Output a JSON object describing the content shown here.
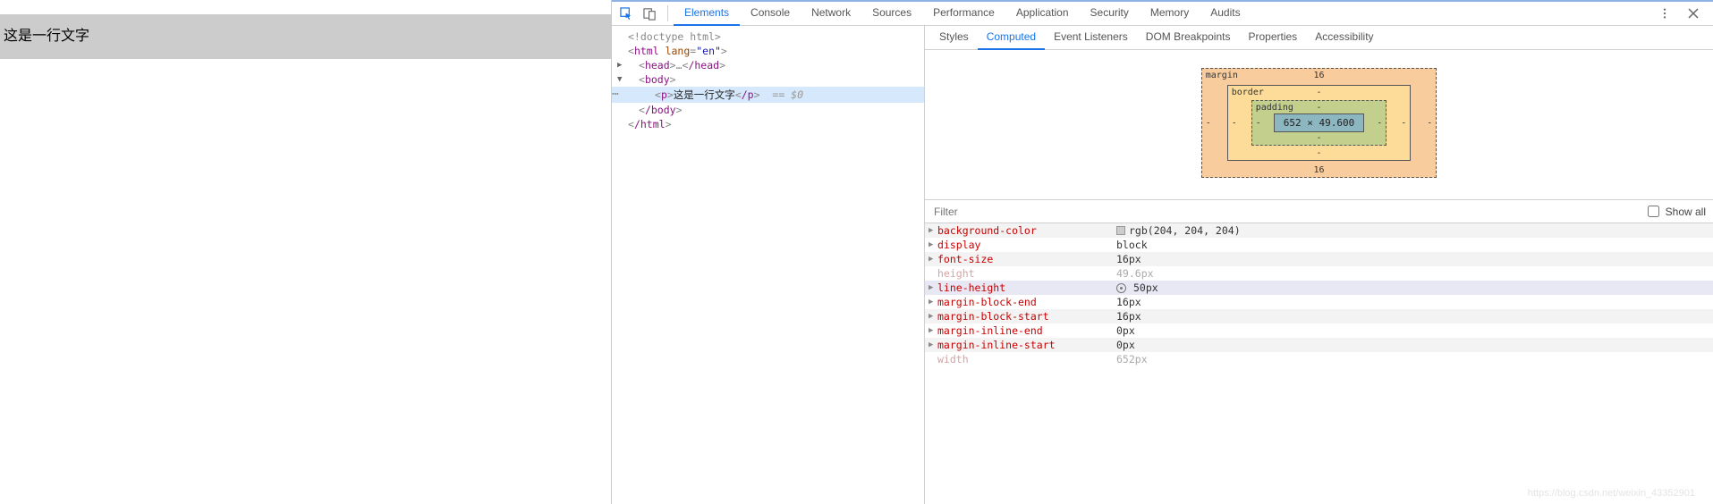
{
  "page": {
    "paragraph_text": "这是一行文字"
  },
  "devtools": {
    "main_tabs": [
      "Elements",
      "Console",
      "Network",
      "Sources",
      "Performance",
      "Application",
      "Security",
      "Memory",
      "Audits"
    ],
    "main_active": "Elements",
    "side_tabs": [
      "Styles",
      "Computed",
      "Event Listeners",
      "DOM Breakpoints",
      "Properties",
      "Accessibility"
    ],
    "side_active": "Computed",
    "dom": {
      "doctype": "<!doctype html>",
      "html_open": "html",
      "html_lang_attr": "lang",
      "html_lang_val": "\"en\"",
      "head_open": "head",
      "head_ellipsis": "…",
      "head_close": "/head",
      "body_open": "body",
      "p_open": "p",
      "p_text": "这是一行文字",
      "p_close": "/p",
      "eq0": "== $0",
      "body_close": "/body",
      "html_close": "/html"
    },
    "box_model": {
      "margin_label": "margin",
      "margin_top": "16",
      "margin_right": "-",
      "margin_bottom": "16",
      "margin_left": "-",
      "border_label": "border",
      "border_top": "-",
      "border_right": "-",
      "border_bottom": "-",
      "border_left": "-",
      "padding_label": "padding",
      "padding_top": "-",
      "padding_right": "-",
      "padding_bottom": "-",
      "padding_left": "-",
      "content": "652 × 49.600"
    },
    "filter_placeholder": "Filter",
    "show_all_label": "Show all",
    "computed_props": [
      {
        "name": "background-color",
        "value": "rgb(204, 204, 204)",
        "swatch": "#cccccc",
        "expandable": true
      },
      {
        "name": "display",
        "value": "block",
        "expandable": true
      },
      {
        "name": "font-size",
        "value": "16px",
        "expandable": true
      },
      {
        "name": "height",
        "value": "49.6px",
        "dim": true
      },
      {
        "name": "line-height",
        "value": "50px",
        "expandable": true,
        "highlight": true,
        "goto": true
      },
      {
        "name": "margin-block-end",
        "value": "16px",
        "expandable": true
      },
      {
        "name": "margin-block-start",
        "value": "16px",
        "expandable": true
      },
      {
        "name": "margin-inline-end",
        "value": "0px",
        "expandable": true
      },
      {
        "name": "margin-inline-start",
        "value": "0px",
        "expandable": true
      },
      {
        "name": "width",
        "value": "652px",
        "dim": true
      }
    ]
  },
  "watermark": "https://blog.csdn.net/weixin_43352901"
}
